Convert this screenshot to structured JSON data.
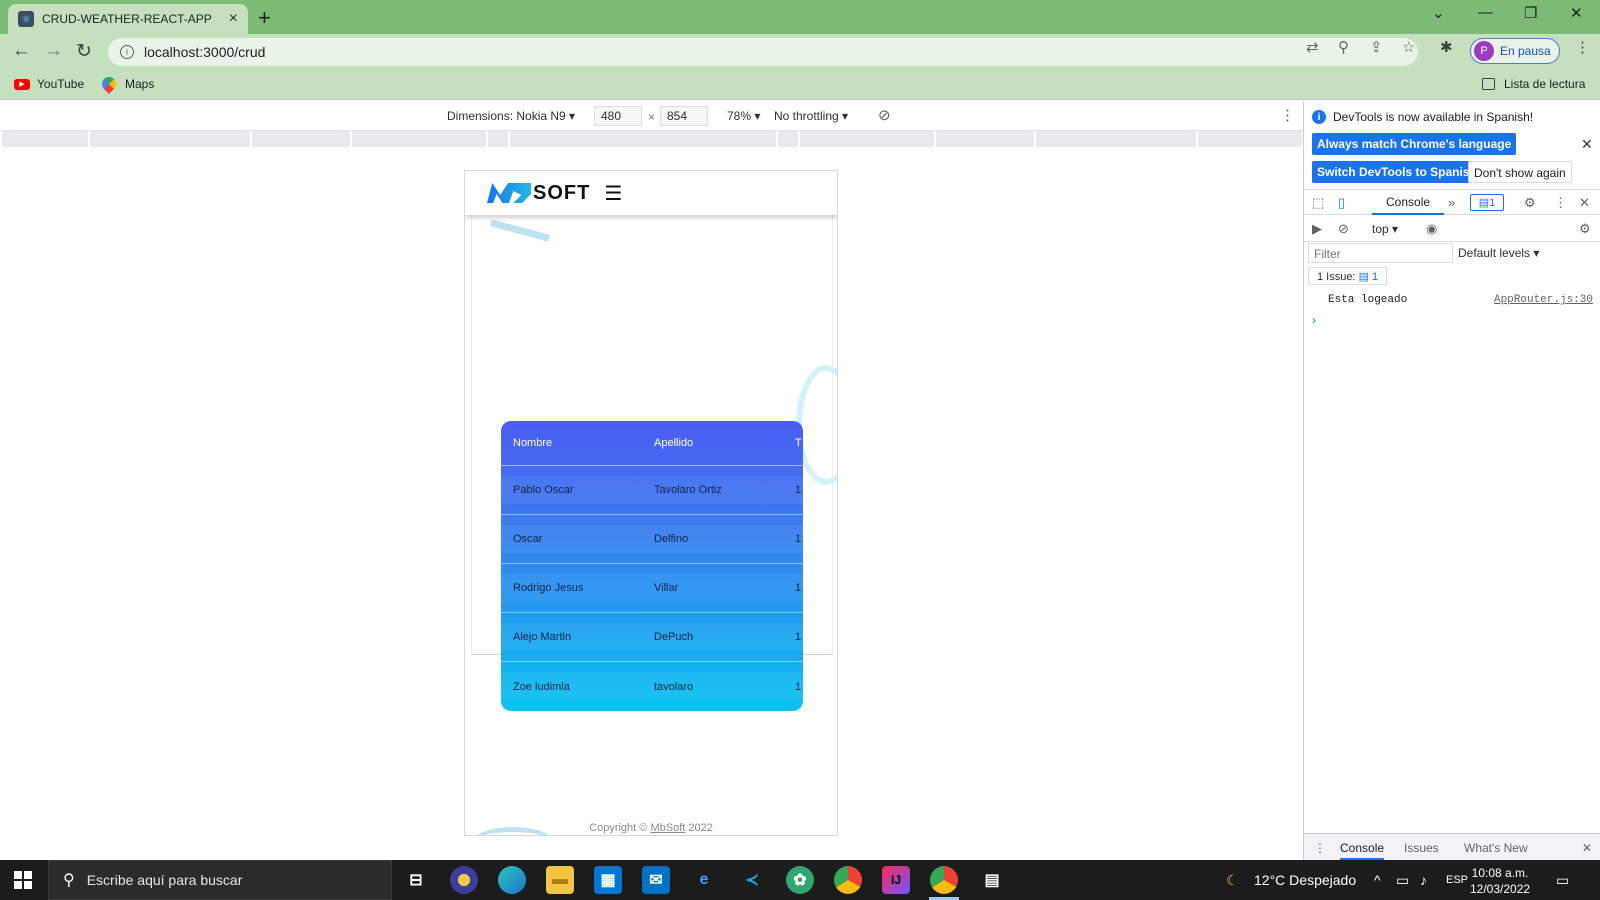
{
  "browser": {
    "tab_title": "CRUD-WEATHER-REACT-APP",
    "url": "localhost:3000/crud",
    "profile_status": "En pausa",
    "profile_initial": "P",
    "bookmarks": [
      {
        "label": "YouTube"
      },
      {
        "label": "Maps"
      }
    ],
    "reading_list": "Lista de lectura"
  },
  "device_toolbar": {
    "device": "Dimensions: Nokia N9",
    "width": "480",
    "height": "854",
    "times": "×",
    "zoom": "78%",
    "throttling": "No throttling"
  },
  "app": {
    "logo_text": "SOFT",
    "table": {
      "headers": [
        "Nombre",
        "Apellido",
        "T"
      ],
      "rows": [
        [
          "Pablo Oscar",
          "Tavolaro Ortiz",
          "1"
        ],
        [
          "Oscar",
          "Delfino",
          "1"
        ],
        [
          "Rodrigo Jesus",
          "Villar",
          "1"
        ],
        [
          "Alejo Martin",
          "DePuch",
          "1"
        ],
        [
          "Zoe ludimla",
          "tavolaro",
          "1"
        ]
      ]
    },
    "footer": {
      "prefix": "Copyright ©",
      "brand": "MbSoft",
      "year": "2022"
    }
  },
  "devtools": {
    "info_text": "DevTools is now available in Spanish!",
    "btn_match": "Always match Chrome's language",
    "btn_switch": "Switch DevTools to Spanish",
    "btn_dont_show": "Don't show again",
    "tab_console": "Console",
    "badge_count": "1",
    "context": "top",
    "filter_placeholder": "Filter",
    "levels": "Default levels",
    "issues_label": "1 Issue:",
    "issues_count": "1",
    "log_message": "Esta logeado",
    "log_source": "AppRouter.js:30",
    "drawer_tabs": [
      "Console",
      "Issues",
      "What's New"
    ]
  },
  "taskbar": {
    "search_placeholder": "Escribe aquí para buscar",
    "weather": "12°C  Despejado",
    "language": "ESP",
    "time": "10:08 a.m.",
    "date": "12/03/2022"
  }
}
